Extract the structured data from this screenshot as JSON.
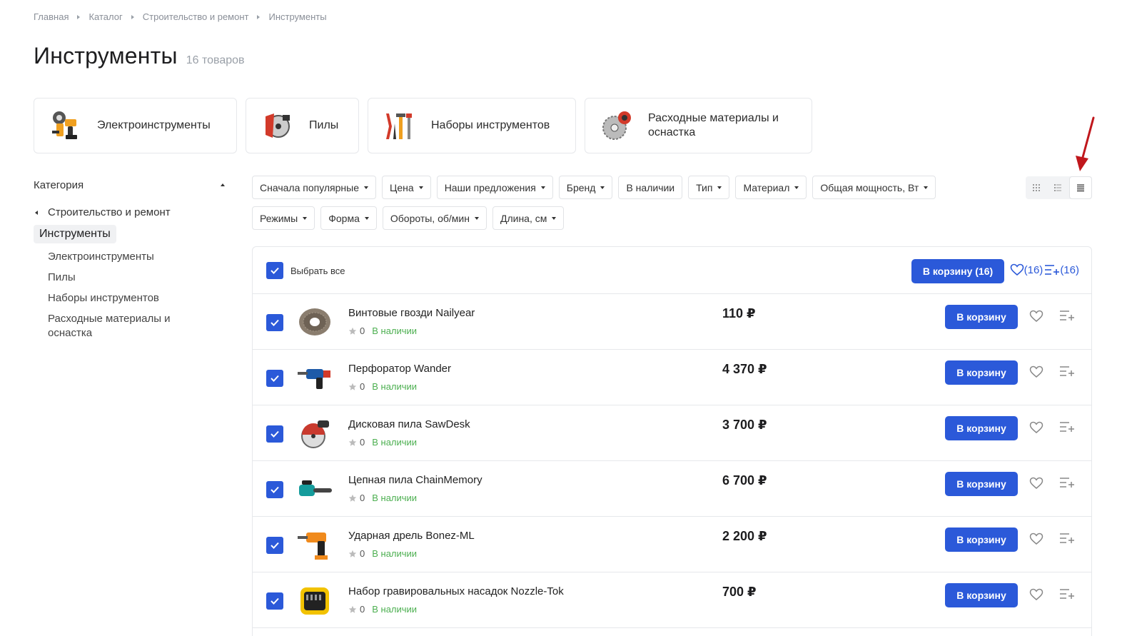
{
  "breadcrumb": [
    "Главная",
    "Каталог",
    "Строительство и ремонт",
    "Инструменты"
  ],
  "page": {
    "title": "Инструменты",
    "count": "16 товаров"
  },
  "categories": [
    {
      "label": "Электроинструменты",
      "icon": "power-tools-icon"
    },
    {
      "label": "Пилы",
      "icon": "saw-icon"
    },
    {
      "label": "Наборы инструментов",
      "icon": "tool-set-icon"
    },
    {
      "label": "Расходные материалы и оснастка",
      "icon": "saw-blade-icon"
    }
  ],
  "sidebar": {
    "heading": "Категория",
    "parent": "Строительство и ремонт",
    "current": "Инструменты",
    "children": [
      "Электроинструменты",
      "Пилы",
      "Наборы инструментов",
      "Расходные материалы и оснастка"
    ]
  },
  "filters": [
    "Сначала популярные",
    "Цена",
    "Наши предложения",
    "Бренд",
    "В наличии",
    "Тип",
    "Материал",
    "Общая мощность, Вт",
    "Режимы",
    "Форма",
    "Обороты, об/мин",
    "Длина, см"
  ],
  "filters_without_dropdown": [
    "В наличии"
  ],
  "view_modes": [
    "grid-view-icon",
    "list-view-icon",
    "compact-list-view-icon"
  ],
  "active_view": "compact-list-view-icon",
  "list_header": {
    "select_all": "Выбрать все",
    "cart_button": "В корзину (16)",
    "fav_count": "(16)",
    "compare_count": "(16)"
  },
  "products": [
    {
      "name": "Винтовые гвозди Nailyear",
      "price": "110 ₽",
      "rating": "0",
      "stock": "В наличии",
      "button": "В корзину",
      "image": "nail-coil"
    },
    {
      "name": "Перфоратор Wander",
      "price": "4 370 ₽",
      "rating": "0",
      "stock": "В наличии",
      "button": "В корзину",
      "image": "rotary-hammer"
    },
    {
      "name": "Дисковая пила SawDesk",
      "price": "3 700 ₽",
      "rating": "0",
      "stock": "В наличии",
      "button": "В корзину",
      "image": "circular-saw"
    },
    {
      "name": "Цепная пила ChainMemory",
      "price": "6 700 ₽",
      "rating": "0",
      "stock": "В наличии",
      "button": "В корзину",
      "image": "chainsaw"
    },
    {
      "name": "Ударная дрель Bonez-ML",
      "price": "2 200 ₽",
      "rating": "0",
      "stock": "В наличии",
      "button": "В корзину",
      "image": "impact-drill"
    },
    {
      "name": "Набор гравировальных насадок Nozzle-Tok",
      "price": "700 ₽",
      "rating": "0",
      "stock": "В наличии",
      "button": "В корзину",
      "image": "bit-set-case"
    }
  ],
  "colors": {
    "accent": "#2b59d9",
    "stock": "#4caf50",
    "arrow": "#c0171c"
  }
}
